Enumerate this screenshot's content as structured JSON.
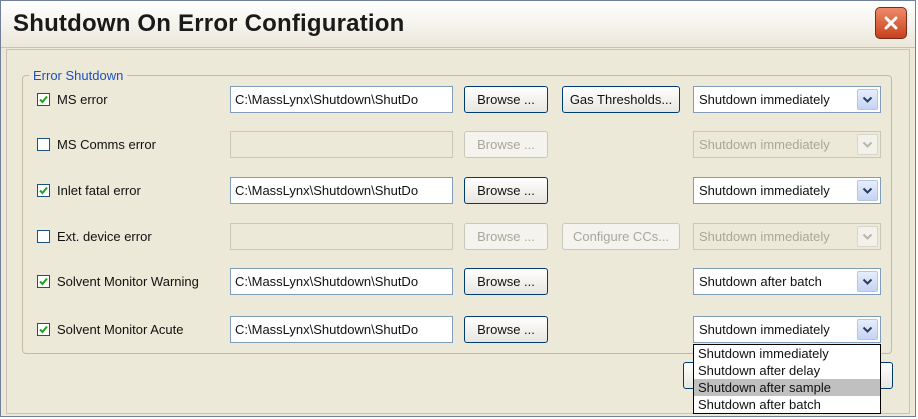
{
  "window": {
    "title": "Shutdown On Error Configuration"
  },
  "group": {
    "legend": "Error Shutdown"
  },
  "buttons": {
    "browse": "Browse ...",
    "gas_thresholds": "Gas Thresholds...",
    "configure_ccs": "Configure CCs..."
  },
  "rows": [
    {
      "label": "MS error",
      "checked": true,
      "path": "C:\\MassLynx\\Shutdown\\ShutDo",
      "action": "Shutdown immediately"
    },
    {
      "label": "MS Comms error",
      "checked": false,
      "path": "",
      "action": "Shutdown immediately"
    },
    {
      "label": "Inlet fatal error",
      "checked": true,
      "path": "C:\\MassLynx\\Shutdown\\ShutDo",
      "action": "Shutdown immediately"
    },
    {
      "label": "Ext. device error",
      "checked": false,
      "path": "",
      "action": "Shutdown immediately"
    },
    {
      "label": "Solvent Monitor Warning",
      "checked": true,
      "path": "C:\\MassLynx\\Shutdown\\ShutDo",
      "action": "Shutdown after batch"
    },
    {
      "label": "Solvent Monitor Acute",
      "checked": true,
      "path": "C:\\MassLynx\\Shutdown\\ShutDo",
      "action": "Shutdown immediately"
    }
  ],
  "dropdown": {
    "options": [
      "Shutdown immediately",
      "Shutdown after delay",
      "Shutdown after sample",
      "Shutdown after batch"
    ],
    "highlighted": "Shutdown after sample"
  }
}
